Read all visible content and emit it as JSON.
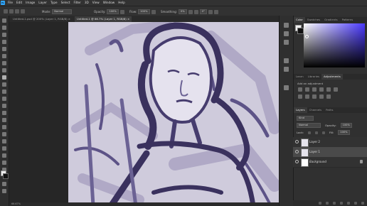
{
  "menu": [
    "File",
    "Edit",
    "Image",
    "Layer",
    "Type",
    "Select",
    "Filter",
    "3D",
    "View",
    "Window",
    "Help"
  ],
  "options": {
    "mode_label": "Mode:",
    "mode_value": "Normal",
    "opacity_label": "Opacity:",
    "opacity_value": "100%",
    "flow_label": "Flow:",
    "flow_value": "100%",
    "smoothing_label": "Smoothing:",
    "smoothing_value": "0%",
    "angle_value": "0°"
  },
  "doc_tabs": [
    {
      "label": "Untitled-1.psd @ 200% (Layer 1, RGB/8) ×"
    },
    {
      "label": "Untitled-1 @ 66.7% (Layer 1, RGB/8) ×"
    }
  ],
  "color_panel": {
    "tabs": [
      "Color",
      "Swatches",
      "Gradients",
      "Patterns"
    ]
  },
  "adjust_panel": {
    "tabs": [
      "Learn",
      "Libraries",
      "Adjustments"
    ],
    "add_label": "Add an adjustment"
  },
  "layers_panel": {
    "tabs": [
      "Layers",
      "Channels",
      "Paths"
    ],
    "kind_label": "Kind",
    "blend_value": "Normal",
    "opacity_label": "Opacity:",
    "opacity_value": "100%",
    "lock_label": "Lock:",
    "fill_label": "Fill:",
    "fill_value": "100%",
    "layers": [
      {
        "name": "Layer 2"
      },
      {
        "name": "Layer 1"
      },
      {
        "name": "Background"
      }
    ]
  },
  "status": {
    "zoom": "66.67%"
  },
  "colors": {
    "accent": "#31a8ff",
    "ink": "#463c6e",
    "paper": "#cfcbdc"
  }
}
